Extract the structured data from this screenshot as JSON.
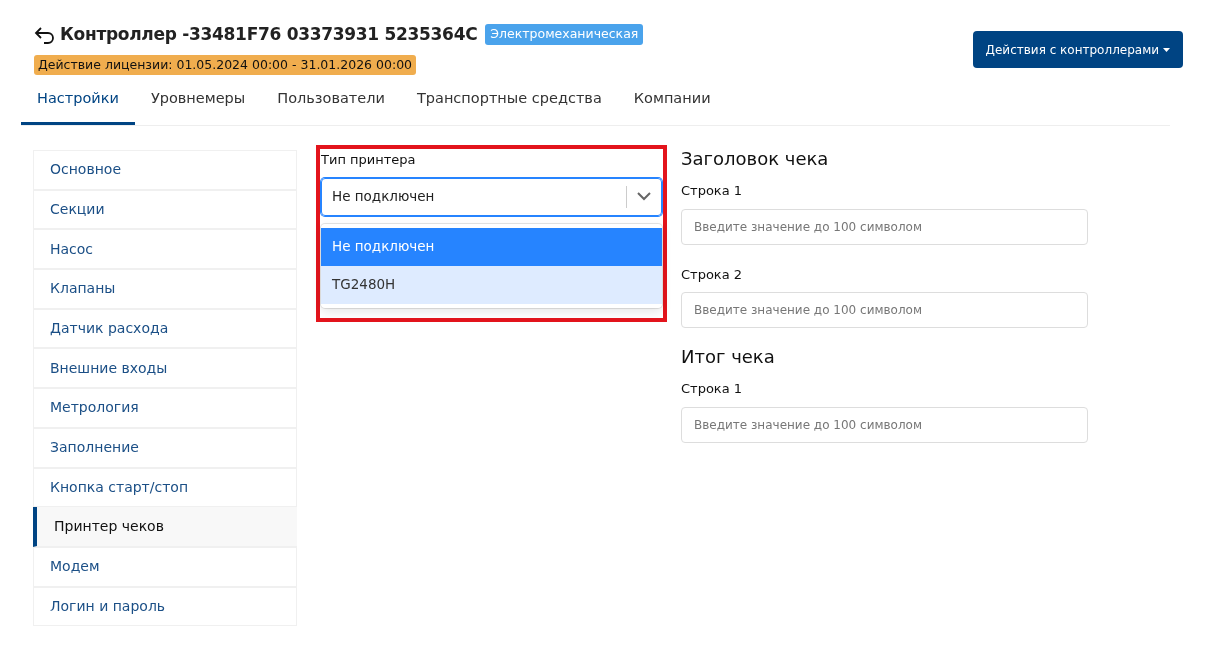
{
  "header": {
    "title": "Контроллер -33481F76 03373931 5235364C",
    "type_badge": "Электромеханическая",
    "license": "Действие лицензии: 01.05.2024 00:00 - 31.01.2026 00:00",
    "actions_button": "Действия с контроллерами"
  },
  "tabs": [
    {
      "label": "Настройки",
      "selected": true
    },
    {
      "label": "Уровнемеры",
      "selected": false
    },
    {
      "label": "Пользователи",
      "selected": false
    },
    {
      "label": "Транспортные средства",
      "selected": false
    },
    {
      "label": "Компании",
      "selected": false
    }
  ],
  "sidebar": {
    "items": [
      {
        "label": "Основное",
        "selected": false
      },
      {
        "label": "Секции",
        "selected": false
      },
      {
        "label": "Насос",
        "selected": false
      },
      {
        "label": "Клапаны",
        "selected": false
      },
      {
        "label": "Датчик расхода",
        "selected": false
      },
      {
        "label": "Внешние входы",
        "selected": false
      },
      {
        "label": "Метрология",
        "selected": false
      },
      {
        "label": "Заполнение",
        "selected": false
      },
      {
        "label": "Кнопка старт/стоп",
        "selected": false
      },
      {
        "label": "Принтер чеков",
        "selected": true
      },
      {
        "label": "Модем",
        "selected": false
      },
      {
        "label": "Логин и пароль",
        "selected": false
      }
    ]
  },
  "printer": {
    "label": "Тип принтера",
    "value": "Не подключен",
    "options": [
      {
        "label": "Не подключен",
        "selected": true
      },
      {
        "label": "TG2480H",
        "selected": false
      }
    ]
  },
  "sections": [
    {
      "title": "Заголовок чека",
      "fields": [
        {
          "label": "Строка 1",
          "placeholder": "Введите значение до 100 символом"
        },
        {
          "label": "Строка 2",
          "placeholder": "Введите значение до 100 символом"
        }
      ]
    },
    {
      "title": "Итог чека",
      "fields": [
        {
          "label": "Строка 1",
          "placeholder": "Введите значение до 100 символом"
        }
      ]
    }
  ]
}
